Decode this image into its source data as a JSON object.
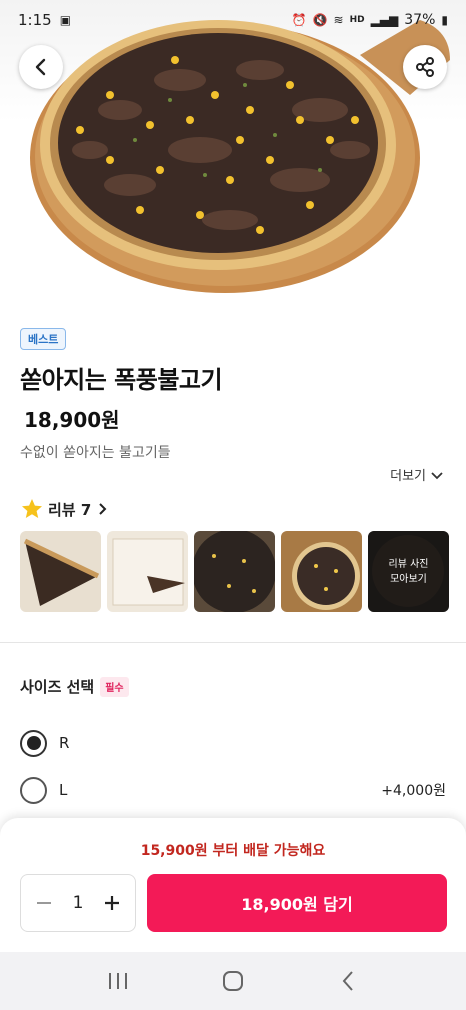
{
  "status_bar": {
    "time": "1:15",
    "signal_label": "HD",
    "battery": "37%"
  },
  "product": {
    "badge": "베스트",
    "title": "쏟아지는 폭풍불고기",
    "price": "18,900원",
    "description": "수없이 쏟아지는 불고기들",
    "more_label": "더보기"
  },
  "reviews": {
    "label": "리뷰 7",
    "more_photos_label": "리뷰 사진\n모아보기"
  },
  "size_section": {
    "title": "사이즈 선택",
    "required_badge": "필수",
    "options": [
      {
        "label": "R",
        "price": "",
        "selected": true
      },
      {
        "label": "L",
        "price": "+4,000원",
        "selected": false
      }
    ]
  },
  "order_bar": {
    "min_order_text": "15,900원 부터 배달 가능해요",
    "quantity": "1",
    "add_button_label": "18,900원 담기"
  },
  "colors": {
    "accent": "#f31a57",
    "min_order": "#c2271f",
    "badge_blue": "#2b74c6"
  }
}
